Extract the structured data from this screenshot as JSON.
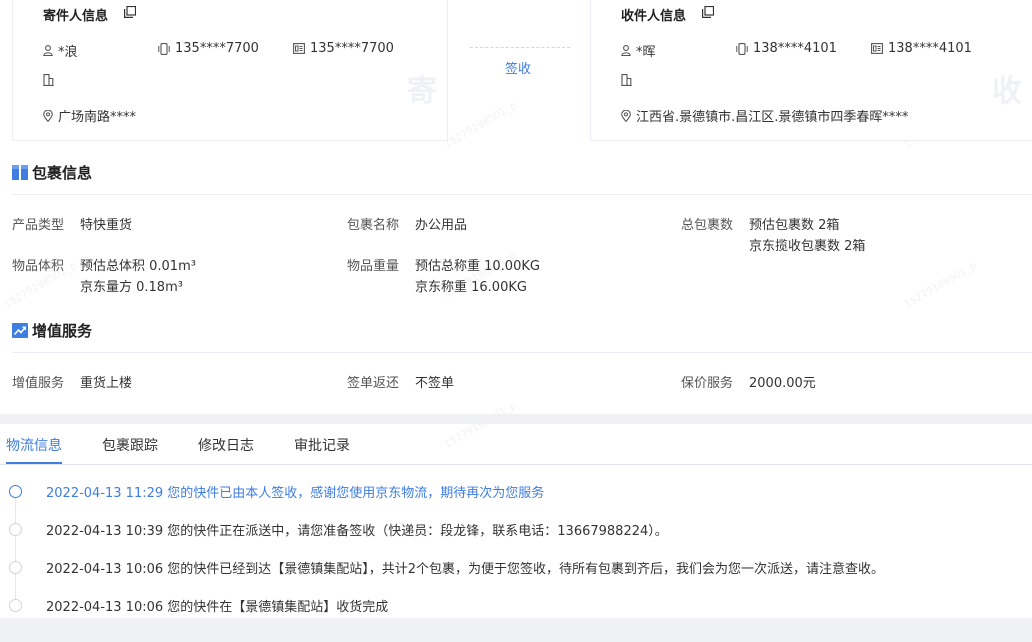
{
  "sender": {
    "title": "寄件人信息",
    "name": "*浪",
    "mobile": "135****7700",
    "phone": "135****7700",
    "company": "",
    "address": "广场南路****",
    "watermark": "寄"
  },
  "receiver": {
    "title": "收件人信息",
    "name": "*晖",
    "mobile": "138****4101",
    "phone": "138****4101",
    "company": "",
    "address": "江西省.景德镇市.昌江区.景德镇市四季春晖****",
    "watermark": "收"
  },
  "sign_status": "签收",
  "package": {
    "title": "包裹信息",
    "product_type_label": "产品类型",
    "product_type": "特快重货",
    "package_name_label": "包裹名称",
    "package_name": "办公用品",
    "total_label": "总包裹数",
    "total_lines": [
      "预估包裹数 2箱",
      "京东揽收包裹数 2箱"
    ],
    "volume_label": "物品体积",
    "volume_lines": [
      "预估总体积 0.01m³",
      "京东量方 0.18m³"
    ],
    "weight_label": "物品重量",
    "weight_lines": [
      "预估总称重 10.00KG",
      "京东称重 16.00KG"
    ]
  },
  "value_added": {
    "title": "增值服务",
    "service_label": "增值服务",
    "service": "重货上楼",
    "return_label": "签单返还",
    "return": "不签单",
    "insurance_label": "保价服务",
    "insurance": "2000.00元"
  },
  "tabs": [
    {
      "label": "物流信息",
      "active": true
    },
    {
      "label": "包裹跟踪",
      "active": false
    },
    {
      "label": "修改日志",
      "active": false
    },
    {
      "label": "审批记录",
      "active": false
    }
  ],
  "timeline": [
    {
      "text": "2022-04-13 11:29 您的快件已由本人签收，感谢您使用京东物流，期待再次为您服务",
      "active": true
    },
    {
      "text": "2022-04-13 10:39 您的快件正在派送中，请您准备签收（快递员：段龙锋，联系电话：13667988224）。",
      "active": false
    },
    {
      "text": "2022-04-13 10:06 您的快件已经到达【景德镇集配站】，共计2个包裹，为便于您签收，待所有包裹到齐后，我们会为您一次派送，请注意查收。",
      "active": false
    },
    {
      "text": "2022-04-13 10:06 您的快件在【景德镇集配站】收货完成",
      "active": false
    }
  ],
  "colors": {
    "accent": "#3f7de0",
    "text": "#333333",
    "band": "#f0f1f4"
  }
}
